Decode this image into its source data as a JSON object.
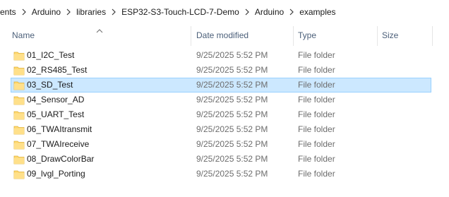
{
  "breadcrumb": {
    "items": [
      "ents",
      "Arduino",
      "libraries",
      "ESP32-S3-Touch-LCD-7-Demo",
      "Arduino",
      "examples"
    ]
  },
  "columns": {
    "name": "Name",
    "date": "Date modified",
    "type": "Type",
    "size": "Size"
  },
  "colors": {
    "selection_bg": "#cce8ff",
    "selection_border": "#99d1ff",
    "folder": "#ffd86e",
    "header_text": "#4c607a"
  },
  "rows": [
    {
      "name": "01_I2C_Test",
      "date": "9/25/2025 5:52 PM",
      "type": "File folder",
      "size": "",
      "selected": false,
      "icon": "folder-icon"
    },
    {
      "name": "02_RS485_Test",
      "date": "9/25/2025 5:52 PM",
      "type": "File folder",
      "size": "",
      "selected": false,
      "icon": "folder-icon"
    },
    {
      "name": "03_SD_Test",
      "date": "9/25/2025 5:52 PM",
      "type": "File folder",
      "size": "",
      "selected": true,
      "icon": "folder-icon"
    },
    {
      "name": "04_Sensor_AD",
      "date": "9/25/2025 5:52 PM",
      "type": "File folder",
      "size": "",
      "selected": false,
      "icon": "folder-icon"
    },
    {
      "name": "05_UART_Test",
      "date": "9/25/2025 5:52 PM",
      "type": "File folder",
      "size": "",
      "selected": false,
      "icon": "folder-icon"
    },
    {
      "name": "06_TWAItransmit",
      "date": "9/25/2025 5:52 PM",
      "type": "File folder",
      "size": "",
      "selected": false,
      "icon": "folder-icon"
    },
    {
      "name": "07_TWAIreceive",
      "date": "9/25/2025 5:52 PM",
      "type": "File folder",
      "size": "",
      "selected": false,
      "icon": "folder-icon"
    },
    {
      "name": "08_DrawColorBar",
      "date": "9/25/2025 5:52 PM",
      "type": "File folder",
      "size": "",
      "selected": false,
      "icon": "folder-icon"
    },
    {
      "name": "09_lvgl_Porting",
      "date": "9/25/2025 5:52 PM",
      "type": "File folder",
      "size": "",
      "selected": false,
      "icon": "folder-icon"
    }
  ]
}
